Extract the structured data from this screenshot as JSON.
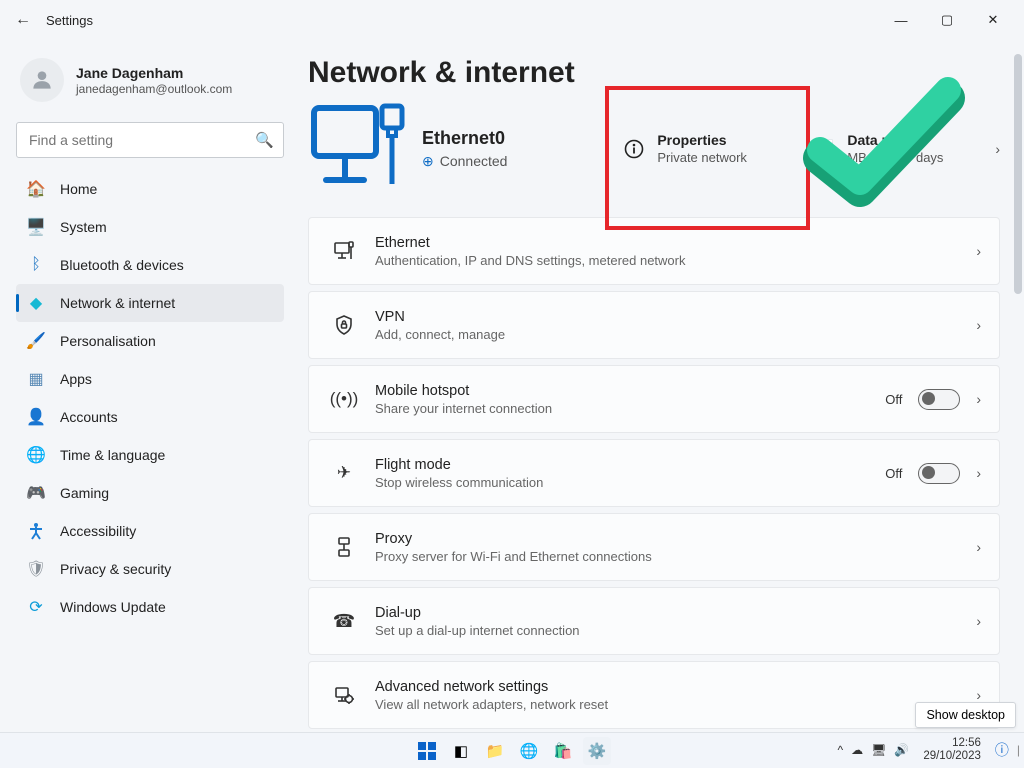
{
  "titlebar": {
    "title": "Settings"
  },
  "profile": {
    "name": "Jane Dagenham",
    "email": "janedagenham@outlook.com"
  },
  "search": {
    "placeholder": "Find a setting"
  },
  "nav": [
    {
      "label": "Home",
      "icon": "🏠",
      "color": "#d57b3e"
    },
    {
      "label": "System",
      "icon": "🖥️",
      "color": "#2a7cc7"
    },
    {
      "label": "Bluetooth & devices",
      "icon": "ᛒ",
      "color": "#2a7cc7"
    },
    {
      "label": "Network & internet",
      "icon": "◆",
      "color": "#17b9d4",
      "active": true
    },
    {
      "label": "Personalisation",
      "icon": "🖌️",
      "color": "#c55a11"
    },
    {
      "label": "Apps",
      "icon": "▦",
      "color": "#5b8bb6"
    },
    {
      "label": "Accounts",
      "icon": "👤",
      "color": "#2fa556"
    },
    {
      "label": "Time & language",
      "icon": "🌐",
      "color": "#1386c2"
    },
    {
      "label": "Gaming",
      "icon": "🎮",
      "color": "#7c8690"
    },
    {
      "label": "Accessibility",
      "icon": "✖",
      "color": "#1c7ed6",
      "a11y": true
    },
    {
      "label": "Privacy & security",
      "icon": "🛡",
      "color": "#8a929a"
    },
    {
      "label": "Windows Update",
      "icon": "⟳",
      "color": "#0d9cd8"
    }
  ],
  "page": {
    "heading": "Network & internet",
    "conn": {
      "name": "Ethernet0",
      "status": "Connected"
    },
    "cards": {
      "properties": {
        "title": "Properties",
        "sub": "Private network"
      },
      "datausage": {
        "title": "Data usage",
        "sub": "MB, last 30 days"
      }
    },
    "rows": [
      {
        "key": "ethernet",
        "title": "Ethernet",
        "desc": "Authentication, IP and DNS settings, metered network"
      },
      {
        "key": "vpn",
        "title": "VPN",
        "desc": "Add, connect, manage"
      },
      {
        "key": "hotspot",
        "title": "Mobile hotspot",
        "desc": "Share your internet connection",
        "toggle": "Off"
      },
      {
        "key": "flight",
        "title": "Flight mode",
        "desc": "Stop wireless communication",
        "toggle": "Off"
      },
      {
        "key": "proxy",
        "title": "Proxy",
        "desc": "Proxy server for Wi-Fi and Ethernet connections"
      },
      {
        "key": "dialup",
        "title": "Dial-up",
        "desc": "Set up a dial-up internet connection"
      },
      {
        "key": "advanced",
        "title": "Advanced network settings",
        "desc": "View all network adapters, network reset"
      }
    ]
  },
  "tray": {
    "time": "12:56",
    "date": "29/10/2023"
  },
  "tooltip": {
    "showdesktop": "Show desktop"
  }
}
